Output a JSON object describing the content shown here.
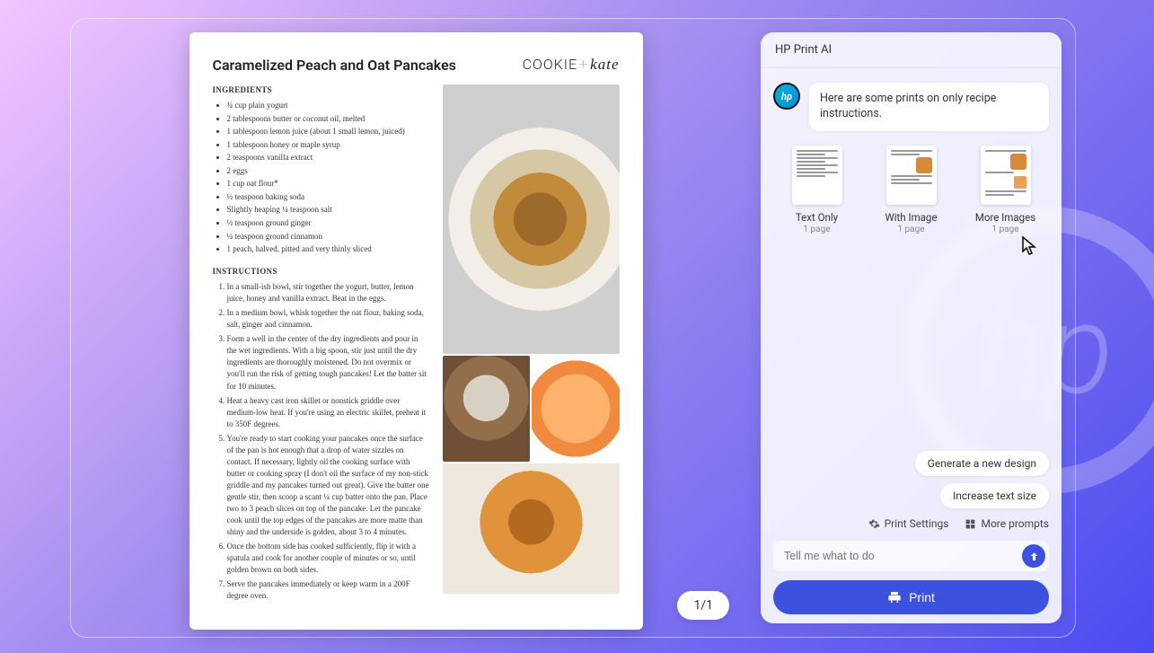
{
  "side": {
    "title": "HP Print AI",
    "message": "Here are some prints on only recipe instructions.",
    "options": [
      {
        "label": "Text Only",
        "sub": "1 page"
      },
      {
        "label": "With Image",
        "sub": "1 page"
      },
      {
        "label": "More Images",
        "sub": "1 page"
      }
    ],
    "chips": [
      "Generate a new design",
      "Increase text size"
    ],
    "settings_label": "Print Settings",
    "more_prompts_label": "More prompts",
    "input_placeholder": "Tell me what to do",
    "print_label": "Print"
  },
  "page_indicator": "1/1",
  "doc": {
    "title": "Caramelized Peach and Oat Pancakes",
    "logo_a": "COOKIE",
    "logo_b": "kate",
    "ingredients_h": "INGREDIENTS",
    "instructions_h": "INSTRUCTIONS",
    "ingredients": [
      "¾ cup plain yogurt",
      "2 tablespoons butter or coconut oil, melted",
      "1 tablespoon lemon juice (about 1 small lemon, juiced)",
      "1 tablespoon honey or maple syrup",
      "2 teaspoons vanilla extract",
      "2 eggs",
      "1 cup oat flour*",
      "½ teaspoon baking soda",
      "Slightly heaping ¼ teaspoon salt",
      "½ teaspoon ground ginger",
      "¼ teaspoon ground cinnamon",
      "1 peach, halved, pitted and very thinly sliced"
    ],
    "instructions": [
      "In a small-ish bowl, stir together the yogurt, butter, lemon juice, honey and vanilla extract. Beat in the eggs.",
      "In a medium bowl, whisk together the oat flour, baking soda, salt, ginger and cinnamon.",
      "Form a well in the center of the dry ingredients and pour in the wet ingredients. With a big spoon, stir just until the dry ingredients are thoroughly moistened. Do not overmix or you'll run the risk of getting tough pancakes! Let the batter sit for 10 minutes.",
      "Heat a heavy cast iron skillet or nonstick griddle over medium-low heat. If you're using an electric skillet, preheat it to 350F degrees.",
      "You're ready to start cooking your pancakes once the surface of the pan is hot enough that a drop of water sizzles on contact. If necessary, lightly oil the cooking surface with butter or cooking spray (I don't oil the surface of my non-stick griddle and my pancakes turned out great). Give the batter one gentle stir, then scoop a scant ¼ cup batter onto the pan. Place two to 3 peach slices on top of the pancake. Let the pancake cook until the top edges of the pancakes are more matte than shiny and the underside is golden, about 3 to 4 minutes.",
      "Once the bottom side has cooked sufficiently, flip it with a spatula and cook for another couple of minutes or so, until golden brown on both sides.",
      "Serve the pancakes immediately or keep warm in a 200F degree oven."
    ]
  }
}
